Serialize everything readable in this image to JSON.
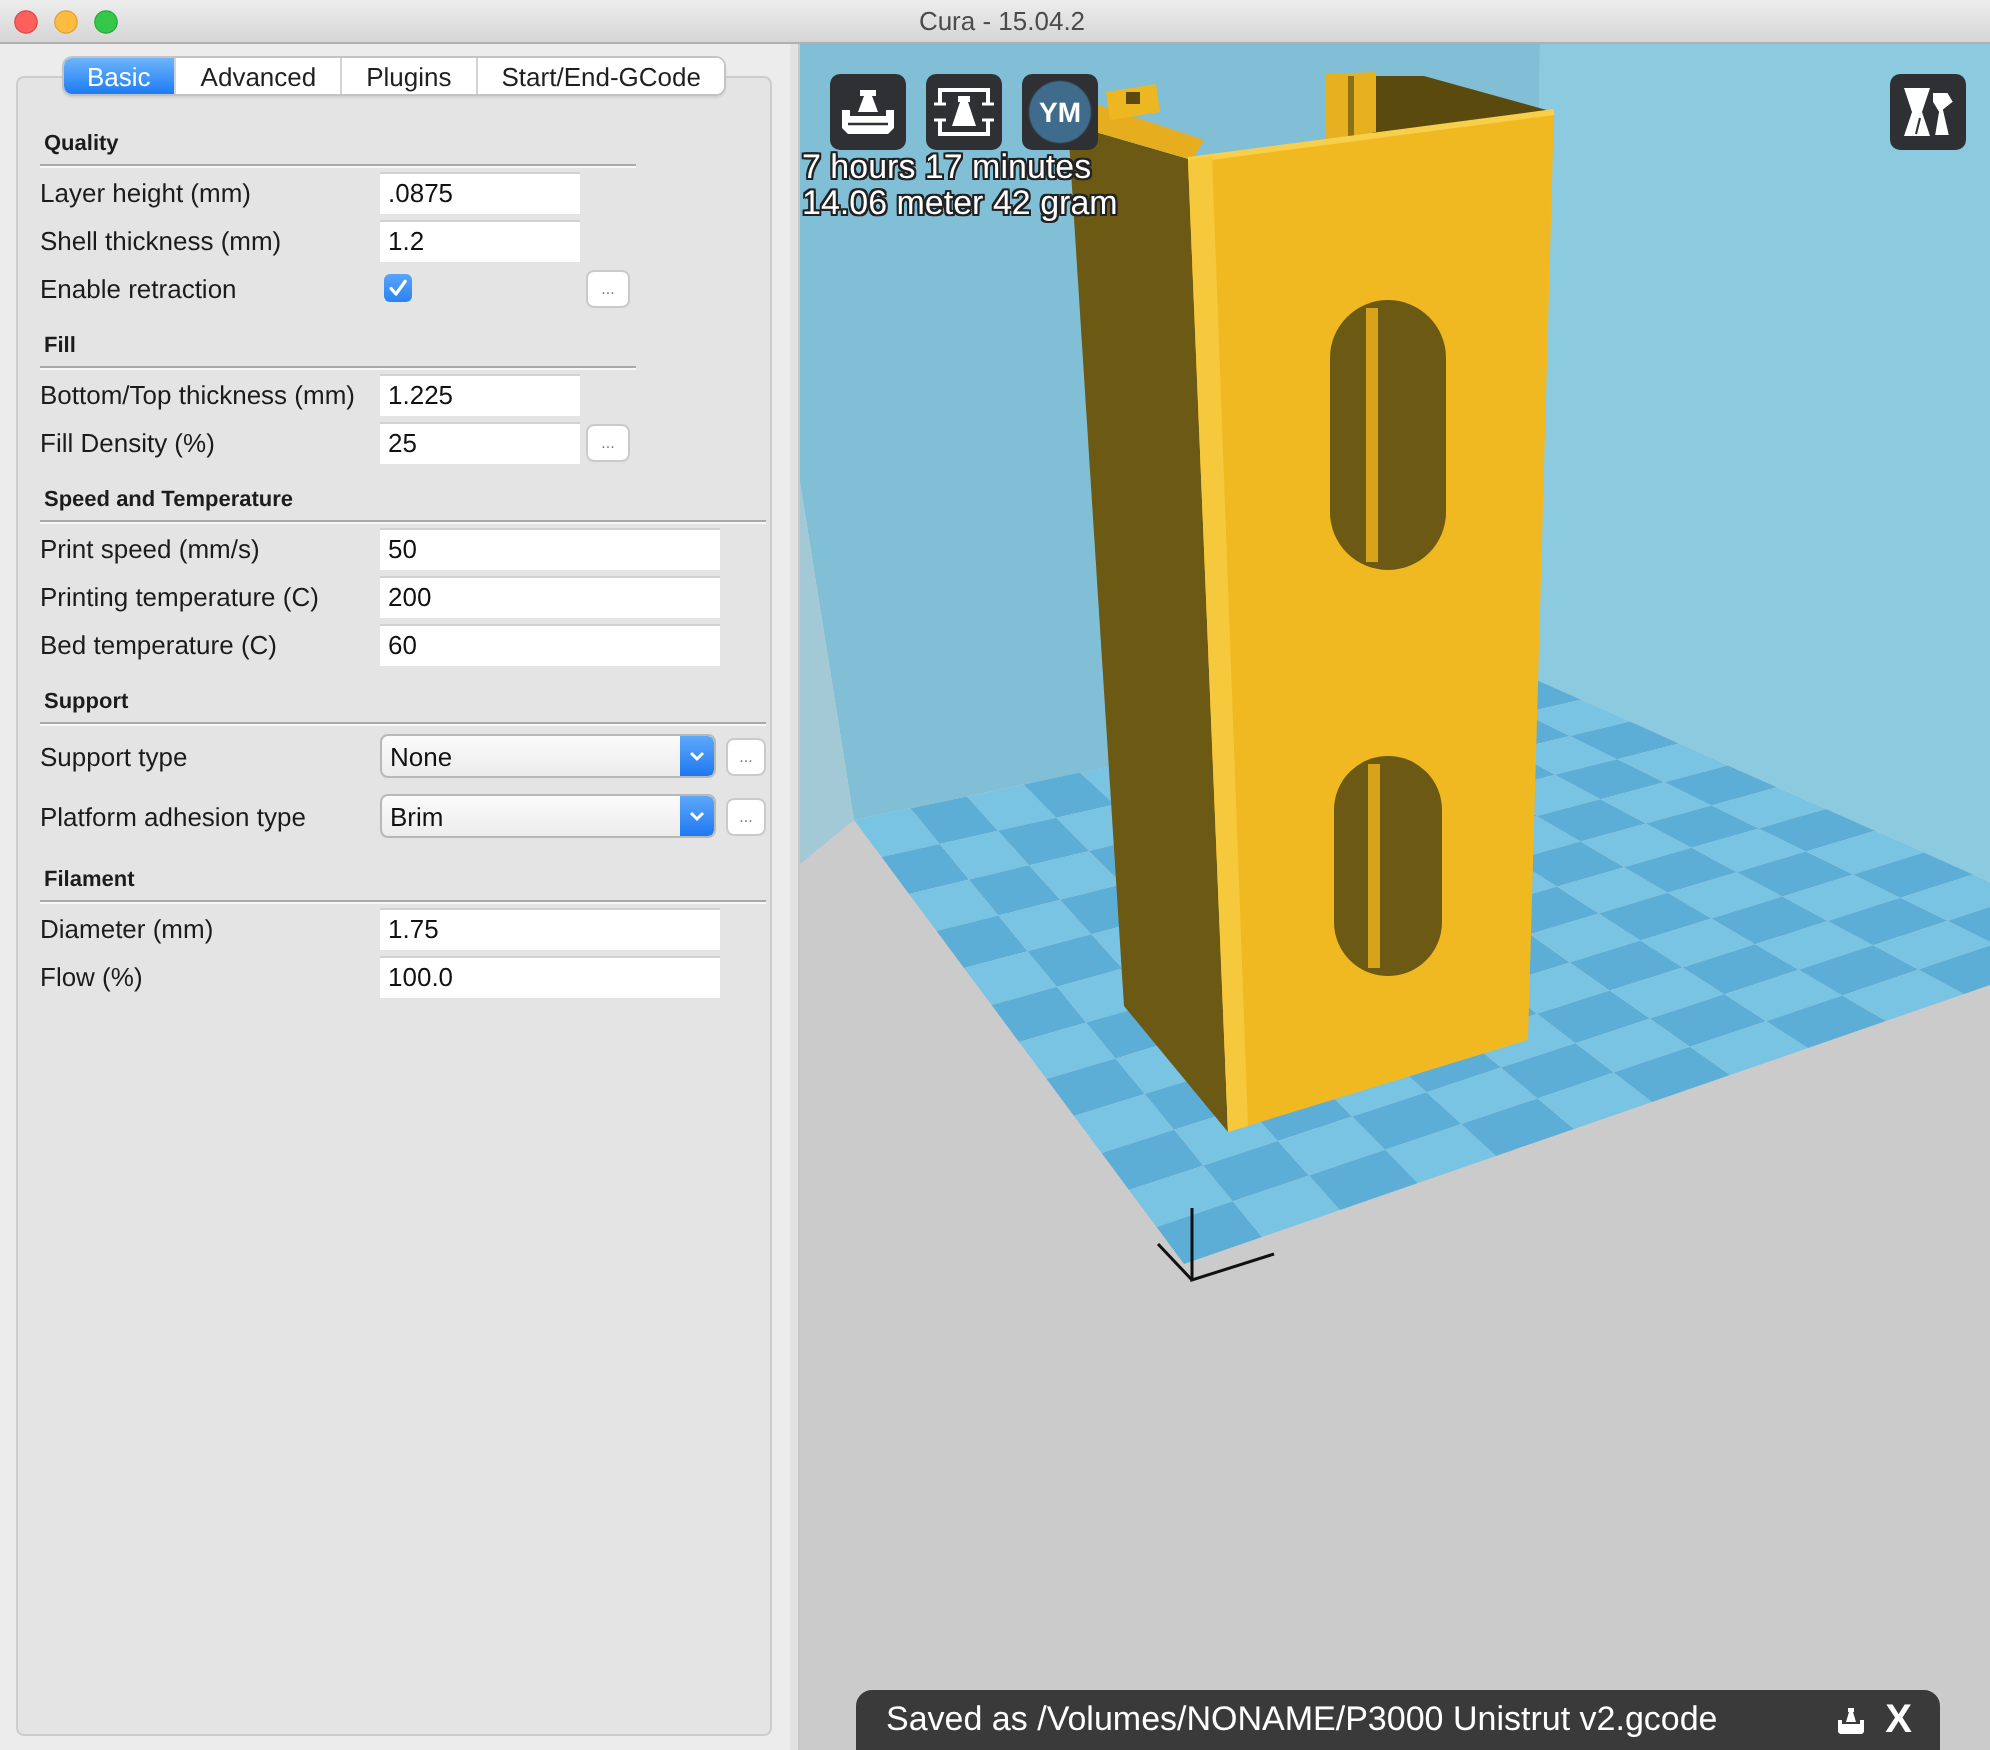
{
  "window": {
    "title": "Cura - 15.04.2"
  },
  "tabs": [
    {
      "label": "Basic",
      "selected": true
    },
    {
      "label": "Advanced",
      "selected": false
    },
    {
      "label": "Plugins",
      "selected": false
    },
    {
      "label": "Start/End-GCode",
      "selected": false
    }
  ],
  "sections": [
    {
      "title": "Quality",
      "rows": [
        {
          "kind": "text",
          "label": "Layer height (mm)",
          "value": ".0875"
        },
        {
          "kind": "text",
          "label": "Shell thickness (mm)",
          "value": "1.2"
        },
        {
          "kind": "checkbox",
          "label": "Enable retraction",
          "checked": true,
          "button": "..."
        }
      ]
    },
    {
      "title": "Fill",
      "rows": [
        {
          "kind": "text",
          "label": "Bottom/Top thickness (mm)",
          "value": "1.225"
        },
        {
          "kind": "text",
          "label": "Fill Density (%)",
          "value": "25",
          "button": "..."
        }
      ]
    },
    {
      "title": "Speed and Temperature",
      "rows": [
        {
          "kind": "text",
          "label": "Print speed (mm/s)",
          "value": "50"
        },
        {
          "kind": "text",
          "label": "Printing temperature (C)",
          "value": "200"
        },
        {
          "kind": "text",
          "label": "Bed temperature (C)",
          "value": "60"
        }
      ]
    },
    {
      "title": "Support",
      "rows": [
        {
          "kind": "select",
          "label": "Support type",
          "value": "None",
          "button": "..."
        },
        {
          "kind": "select",
          "label": "Platform adhesion type",
          "value": "Brim",
          "button": "..."
        }
      ]
    },
    {
      "title": "Filament",
      "rows": [
        {
          "kind": "text",
          "label": "Diameter (mm)",
          "value": "1.75"
        },
        {
          "kind": "text",
          "label": "Flow (%)",
          "value": "100.0"
        }
      ]
    }
  ],
  "viewport": {
    "avatar": "YM",
    "print_time": "7 hours 17 minutes",
    "material": "14.06 meter 42 gram"
  },
  "notification": {
    "message": "Saved as /Volumes/NONAME/P3000 Unistrut v2.gcode",
    "close": "X"
  }
}
